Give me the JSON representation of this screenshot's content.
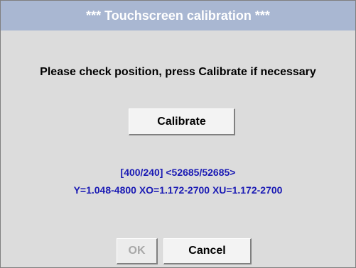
{
  "window": {
    "title": "***  Touchscreen calibration  ***"
  },
  "message": "Please check position, press Calibrate if necessary",
  "buttons": {
    "calibrate": "Calibrate",
    "ok": "OK",
    "cancel": "Cancel"
  },
  "calibration_info": {
    "line1": "[400/240] <52685/52685>",
    "line2": "Y=1.048-4800  XO=1.172-2700  XU=1.172-2700"
  },
  "colors": {
    "title_bar": "#a9b7d2",
    "background": "#dcdcdc",
    "info_text": "#1a1ab4",
    "disabled_text": "#a8a8a8"
  }
}
